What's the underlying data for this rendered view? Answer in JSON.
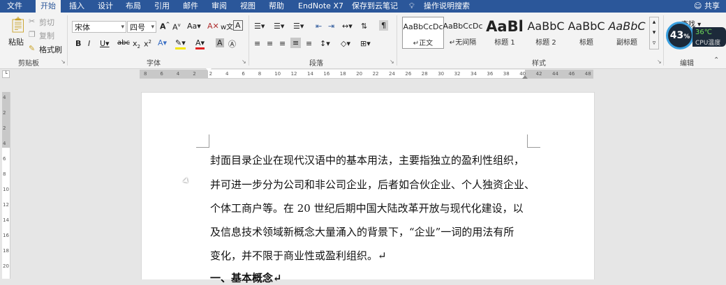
{
  "tabs": [
    "文件",
    "开始",
    "插入",
    "设计",
    "布局",
    "引用",
    "邮件",
    "审阅",
    "视图",
    "帮助",
    "EndNote X7",
    "保存到云笔记",
    "操作说明搜索"
  ],
  "active_tab": "开始",
  "share_label": "共享",
  "clipboard": {
    "paste": "粘贴",
    "cut": "剪切",
    "copy": "复制",
    "format_painter": "格式刷",
    "group": "剪贴板"
  },
  "font": {
    "name": "宋体",
    "size": "四号",
    "group": "字体"
  },
  "paragraph": {
    "group": "段落"
  },
  "styles": {
    "group": "样式",
    "items": [
      {
        "preview": "AaBbCcDc",
        "name": "正文"
      },
      {
        "preview": "AaBbCcDc",
        "name": "无间隔"
      },
      {
        "preview": "AaBl",
        "name": "标题 1"
      },
      {
        "preview": "AaBbC",
        "name": "标题 2"
      },
      {
        "preview": "AaBbC",
        "name": "标题"
      },
      {
        "preview": "AaBbC",
        "name": "副标题"
      }
    ]
  },
  "editing": {
    "find": "查找",
    "group": "编辑"
  },
  "widget": {
    "percent": "43",
    "percent_sign": "%",
    "temp": "36℃",
    "label": "CPU温度"
  },
  "ruler_labels": [
    "8",
    "6",
    "4",
    "2",
    "2",
    "4",
    "6",
    "8",
    "10",
    "12",
    "14",
    "16",
    "18",
    "20",
    "22",
    "24",
    "26",
    "28",
    "30",
    "32",
    "34",
    "36",
    "38",
    "40",
    "42",
    "44",
    "46",
    "48"
  ],
  "vruler_labels": [
    "4",
    "2",
    "2",
    "4",
    "6",
    "8",
    "10",
    "12",
    "14",
    "16",
    "18",
    "20"
  ],
  "document": {
    "lines": [
      "封面目录企业在现代汉语中的基本用法，主要指独立的盈利性组织，",
      "并可进一步分为公司和非公司企业，后者如合伙企业、个人独资企业、",
      "个体工商户等。在 20 世纪后期中国大陆改革开放与现代化建设，以",
      "及信息技术领域新概念大量涌入的背景下，“企业”一词的用法有所",
      "变化，并不限于商业性或盈利组织。↵"
    ],
    "heading": "一、基本概念↵"
  }
}
